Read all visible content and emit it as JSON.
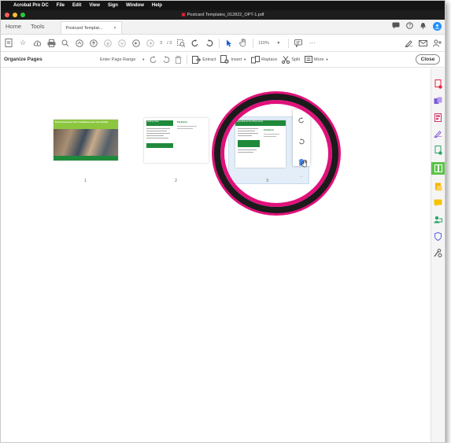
{
  "menubar": {
    "app_name": "Acrobat Pro DC",
    "items": [
      "File",
      "Edit",
      "View",
      "Sign",
      "Window",
      "Help"
    ]
  },
  "titlebar": {
    "title": "Postcard Templates_012822_OPT-1.pdf"
  },
  "tabs": {
    "home": "Home",
    "tools": "Tools",
    "document": "Postcard Templat...",
    "close_glyph": "×"
  },
  "toolbar": {
    "page_current": "3",
    "page_total": "/ 3",
    "zoom": "110%"
  },
  "organize": {
    "title": "Organize Pages",
    "page_range": "Enter Page Range",
    "extract": "Extract",
    "insert": "Insert",
    "replace": "Replace",
    "split": "Split",
    "more": "More",
    "close": "Close"
  },
  "thumbnails": [
    {
      "page": "1",
      "banner": "Postcard green text. Complete your own family."
    },
    {
      "page": "2",
      "heading": "Mailing Ideas",
      "brand": "Parkland"
    },
    {
      "page": "3",
      "heading": "Home Ideas for the Whole Family",
      "brand": "Parkland"
    }
  ],
  "colors": {
    "accent_green": "#1f8a3b",
    "lime": "#8cc63f",
    "ring": "#e0117a",
    "rail_active": "#5cc34a"
  }
}
